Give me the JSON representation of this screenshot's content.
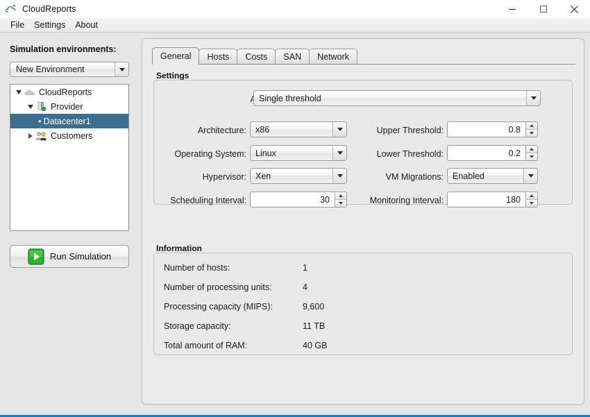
{
  "window": {
    "title": "CloudReports",
    "title_icon": "cloud-icon",
    "controls": {
      "minimize": "minimize-icon",
      "maximize": "maximize-icon",
      "close": "close-icon"
    },
    "accent_color": "#1a80c4"
  },
  "menubar": {
    "items": [
      "File",
      "Settings",
      "About"
    ]
  },
  "sidebar": {
    "label": "Simulation environments:",
    "environment_combo": {
      "value": "New Environment"
    },
    "tree": [
      {
        "label": "CloudReports",
        "icon": "cloud-icon",
        "twisty": "expanded",
        "indent": 0,
        "selected": false
      },
      {
        "label": "Provider",
        "icon": "provider-icon",
        "twisty": "expanded",
        "indent": 1,
        "selected": false
      },
      {
        "label": "Datacenter1",
        "icon": "bullet-icon",
        "twisty": "none",
        "indent": 2,
        "selected": true
      },
      {
        "label": "Customers",
        "icon": "customers-icon",
        "twisty": "collapsed",
        "indent": 1,
        "selected": false
      }
    ],
    "selection_color": "#3d6e91",
    "run_button": {
      "label": "Run Simulation",
      "icon": "play-icon",
      "icon_color": "#2faf2f"
    }
  },
  "tabs": [
    {
      "label": "General",
      "active": true
    },
    {
      "label": "Hosts",
      "active": false
    },
    {
      "label": "Costs",
      "active": false
    },
    {
      "label": "SAN",
      "active": false
    },
    {
      "label": "Network",
      "active": false
    }
  ],
  "settings": {
    "title": "Settings",
    "allocation_policy": {
      "label": "Allocation Policy:",
      "value": "Single threshold"
    },
    "architecture": {
      "label": "Architecture:",
      "value": "x86"
    },
    "operating_system": {
      "label": "Operating System:",
      "value": "Linux"
    },
    "hypervisor": {
      "label": "Hypervisor:",
      "value": "Xen"
    },
    "scheduling_interval": {
      "label": "Scheduling Interval:",
      "value": "30"
    },
    "upper_threshold": {
      "label": "Upper Threshold:",
      "value": "0.8"
    },
    "lower_threshold": {
      "label": "Lower Threshold:",
      "value": "0.2"
    },
    "vm_migrations": {
      "label": "VM Migrations:",
      "value": "Enabled"
    },
    "monitoring_interval": {
      "label": "Monitoring Interval:",
      "value": "180"
    }
  },
  "information": {
    "title": "Information",
    "rows": [
      {
        "label": "Number of hosts:",
        "value": "1"
      },
      {
        "label": "Number of processing units:",
        "value": "4"
      },
      {
        "label": "Processing capacity (MIPS):",
        "value": "9,600"
      },
      {
        "label": "Storage capacity:",
        "value": "11 TB"
      },
      {
        "label": "Total amount of RAM:",
        "value": "40 GB"
      }
    ]
  }
}
